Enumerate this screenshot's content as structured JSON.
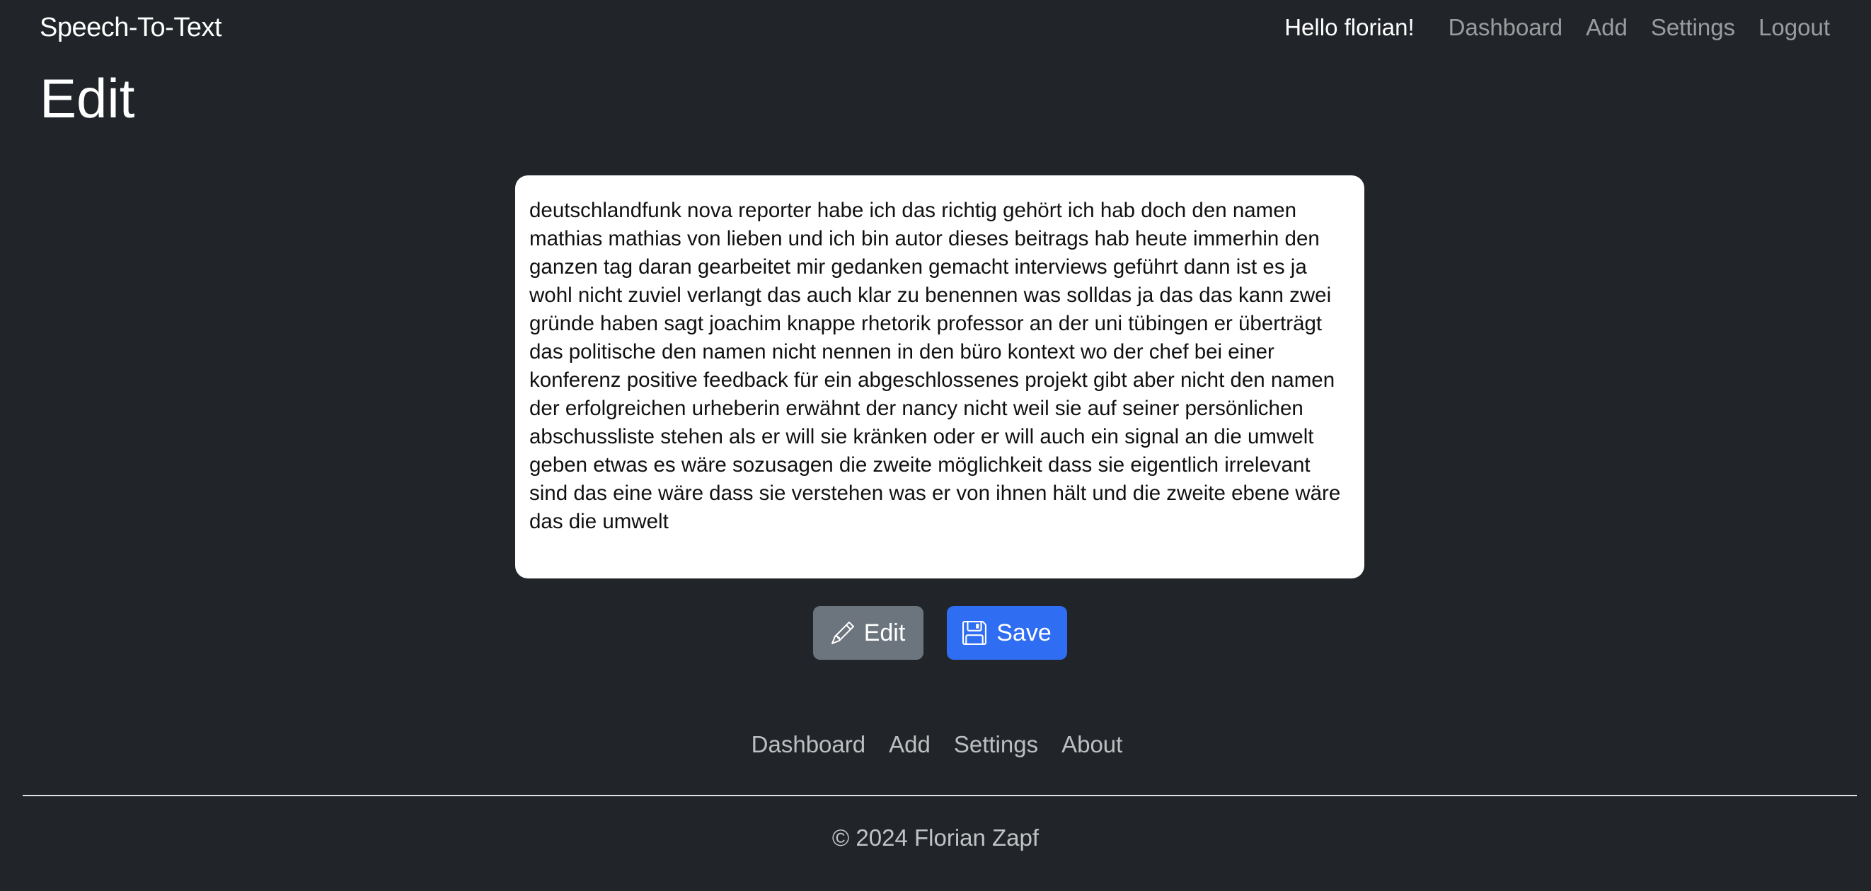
{
  "navbar": {
    "brand": "Speech-To-Text",
    "greeting": "Hello florian!",
    "links": [
      "Dashboard",
      "Add",
      "Settings",
      "Logout"
    ]
  },
  "page": {
    "title": "Edit"
  },
  "editor": {
    "text": "deutschlandfunk nova reporter habe ich das richtig gehört ich hab doch den namen mathias mathias von lieben und ich bin autor dieses beitrags hab heute immerhin den ganzen tag daran gearbeitet mir gedanken gemacht interviews geführt dann ist es ja wohl nicht zuviel verlangt das auch klar zu benennen was solldas ja das das kann zwei gründe haben sagt joachim knappe rhetorik professor an der uni tübingen er überträgt das politische den namen nicht nennen in den büro kontext wo der chef bei einer konferenz positive feedback für ein abgeschlossenes projekt gibt aber nicht den namen der erfolgreichen urheberin erwähnt der nancy nicht weil sie auf seiner persönlichen abschussliste stehen als er will sie kränken oder er will auch ein signal an die umwelt geben etwas es wäre sozusagen die zweite möglichkeit dass sie eigentlich irrelevant sind das eine wäre dass sie verstehen was er von ihnen hält und die zweite ebene wäre das die umwelt"
  },
  "actions": {
    "edit_label": "Edit",
    "edit_icon": "pencil-icon",
    "save_label": "Save",
    "save_icon": "floppy-disk-icon",
    "edit_color": "#6c757d",
    "save_color": "#2f6ef2"
  },
  "footer": {
    "links": [
      "Dashboard",
      "Add",
      "Settings",
      "About"
    ],
    "copyright": "© 2024 Florian Zapf"
  },
  "colors": {
    "background": "#212529"
  }
}
